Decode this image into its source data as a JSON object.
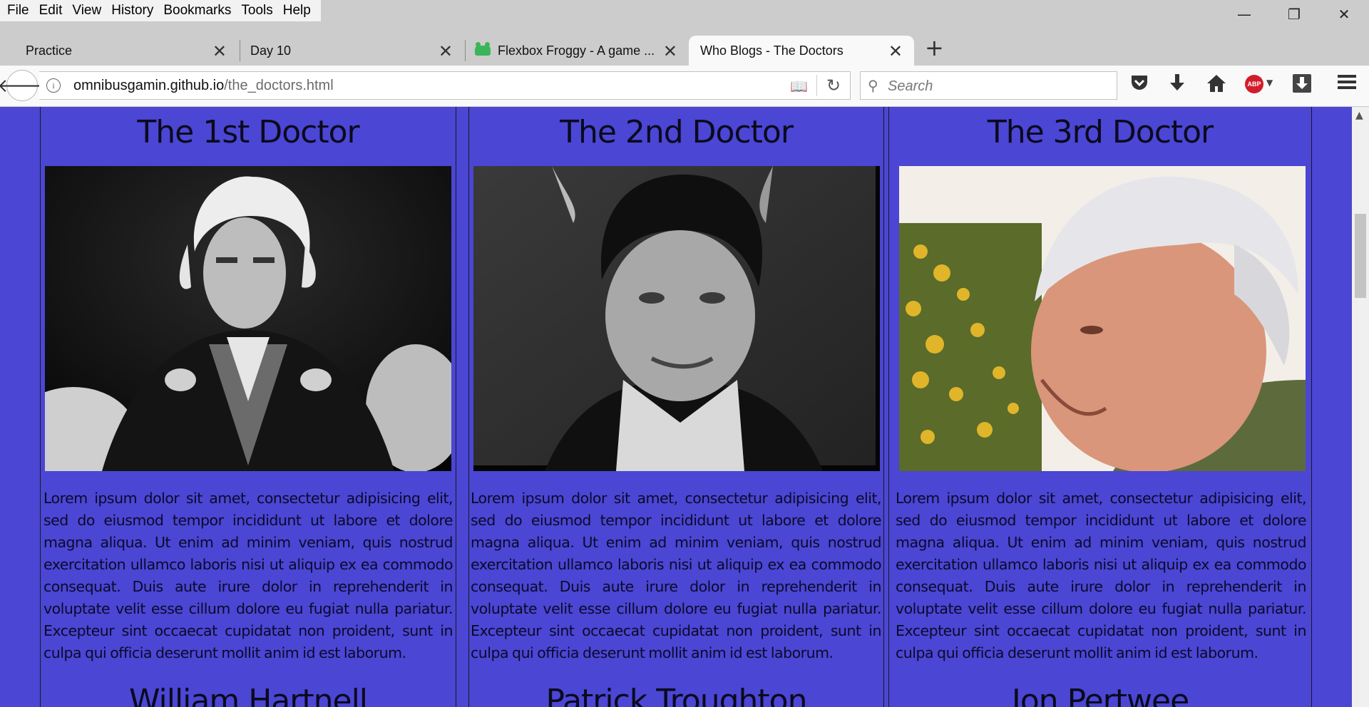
{
  "menu": [
    "File",
    "Edit",
    "View",
    "History",
    "Bookmarks",
    "Tools",
    "Help"
  ],
  "window_controls": {
    "minimize": "—",
    "restore": "❐",
    "close": "✕"
  },
  "tabs": [
    {
      "label": "Practice"
    },
    {
      "label": "Day 10"
    },
    {
      "label": "Flexbox Froggy - A game ..."
    },
    {
      "label": "Who Blogs - The Doctors"
    }
  ],
  "address": {
    "domain": "omnibusgamin.github.io",
    "path": "/the_doctors.html"
  },
  "search": {
    "placeholder": "Search"
  },
  "abp_label": "ABP",
  "doctors": [
    {
      "title": "The 1st Doctor",
      "name": "William Hartnell",
      "text": "Lorem ipsum dolor sit amet, consectetur adipisicing elit, sed do eiusmod tempor incididunt ut labore et dolore magna aliqua. Ut enim ad minim veniam, quis nostrud exercitation ullamco laboris nisi ut aliquip ex ea commodo consequat. Duis aute irure dolor in reprehenderit in voluptate velit esse cillum dolore eu fugiat nulla pariatur. Excepteur sint occaecat cupidatat non proident, sunt in culpa qui officia deserunt mollit anim id est laborum."
    },
    {
      "title": "The 2nd Doctor",
      "name": "Patrick Troughton",
      "text": "Lorem ipsum dolor sit amet, consectetur adipisicing elit, sed do eiusmod tempor incididunt ut labore et dolore magna aliqua. Ut enim ad minim veniam, quis nostrud exercitation ullamco laboris nisi ut aliquip ex ea commodo consequat. Duis aute irure dolor in reprehenderit in voluptate velit esse cillum dolore eu fugiat nulla pariatur. Excepteur sint occaecat cupidatat non proident, sunt in culpa qui officia deserunt mollit anim id est laborum."
    },
    {
      "title": "The 3rd Doctor",
      "name": "Jon Pertwee",
      "text": "Lorem ipsum dolor sit amet, consectetur adipisicing elit, sed do eiusmod tempor incididunt ut labore et dolore magna aliqua. Ut enim ad minim veniam, quis nostrud exercitation ullamco laboris nisi ut aliquip ex ea commodo consequat. Duis aute irure dolor in reprehenderit in voluptate velit esse cillum dolore eu fugiat nulla pariatur. Excepteur sint occaecat cupidatat non proident, sunt in culpa qui officia deserunt mollit anim id est laborum."
    }
  ],
  "colors": {
    "page_background": "#4b46d3",
    "abp_red": "#d31c2a"
  }
}
